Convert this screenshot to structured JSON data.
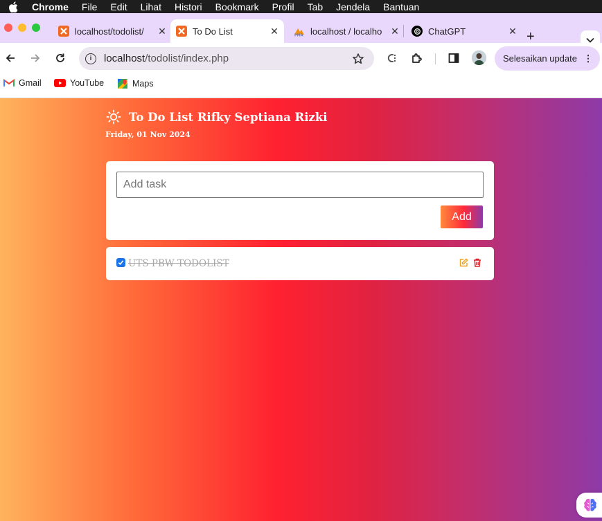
{
  "menubar": {
    "items": [
      "Chrome",
      "File",
      "Edit",
      "Lihat",
      "Histori",
      "Bookmark",
      "Profil",
      "Tab",
      "Jendela",
      "Bantuan"
    ]
  },
  "tabs": [
    {
      "title": "localhost/todolist/",
      "favicon": "xampp-icon",
      "active": false
    },
    {
      "title": "To Do List",
      "favicon": "xampp-icon",
      "active": true
    },
    {
      "title": "localhost / localho",
      "favicon": "phpmyadmin-icon",
      "active": false
    },
    {
      "title": "ChatGPT",
      "favicon": "chatgpt-icon",
      "active": false
    }
  ],
  "address_bar": {
    "host": "localhost",
    "path": "/todolist/index.php"
  },
  "update_button": "Selesaikan update",
  "bookmarks": [
    {
      "label": "Gmail",
      "icon": "gmail-icon"
    },
    {
      "label": "YouTube",
      "icon": "youtube-icon"
    },
    {
      "label": "Maps",
      "icon": "maps-icon"
    }
  ],
  "app": {
    "title": "To Do List Rifky Septiana Rizki",
    "date": "Friday, 01 Nov 2024",
    "input_placeholder": "Add task",
    "input_value": "",
    "add_label": "Add"
  },
  "tasks": [
    {
      "text": "UTS PBW TODOLIST",
      "done": true
    }
  ],
  "colors": {
    "gradient": [
      "#ffb35c",
      "#ff2130",
      "#8e3aa8"
    ],
    "tab_strip": "#e9d8fb",
    "edit_icon": "#f0a020",
    "delete_icon": "#e0202a"
  }
}
